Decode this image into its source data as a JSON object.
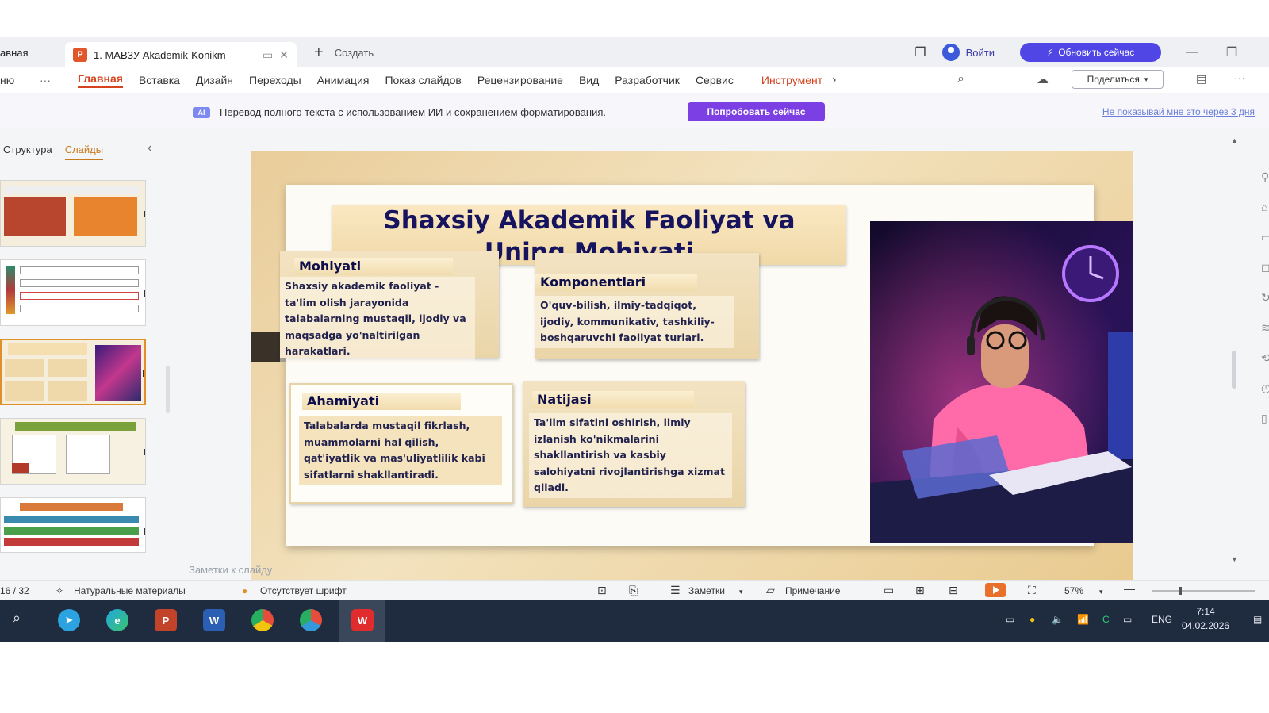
{
  "titlebar": {
    "home_tab": "авная",
    "doc_tab": {
      "badge": "P",
      "name": "1. МАВЗУ Akademik-Konikm"
    },
    "new_label": "Создать",
    "login_label": "Войти",
    "update_label": "Обновить сейчас"
  },
  "ribbon": {
    "menu_label": "ню",
    "tabs": [
      "Главная",
      "Вставка",
      "Дизайн",
      "Переходы",
      "Анимация",
      "Показ слайдов",
      "Рецензирование",
      "Вид",
      "Разработчик",
      "Сервис"
    ],
    "tools_label": "Инструмент",
    "share_label": "Поделиться"
  },
  "banner": {
    "ai_badge": "AI",
    "text": "Перевод полного текста с использованием ИИ и сохранением форматирования.",
    "try_label": "Попробовать сейчас",
    "dismiss_label": "Не показывай мне это через 3 дня"
  },
  "leftpanel": {
    "tab_structure": "Структура",
    "tab_slides": "Слайды",
    "add_label": "+"
  },
  "slide": {
    "title_line1": "Shaxsiy Akademik Faoliyat va",
    "title_line2": "Uning Mohiyati",
    "cards": {
      "mohiyati": {
        "heading": "Mohiyati",
        "body": "Shaxsiy akademik faoliyat - ta'lim olish jarayonida talabalarning mustaqil, ijodiy va maqsadga yo'naltirilgan harakatlari."
      },
      "komponentlari": {
        "heading": "Komponentlari",
        "body": "O'quv-bilish, ilmiy-tadqiqot, ijodiy, kommunikativ, tashkiliy-boshqaruvchi faoliyat turlari."
      },
      "ahamiyati": {
        "heading": "Ahamiyati",
        "body": "Talabalarda mustaqil fikrlash, muammolarni hal qilish, qat'iyatlik va mas'uliyatlilik kabi sifatlarni shakllantiradi."
      },
      "natijasi": {
        "heading": "Natijasi",
        "body": "Ta'lim sifatini oshirish, ilmiy izlanish ko'nikmalarini shakllantirish va kasbiy salohiyatni rivojlantirishga xizmat qiladi."
      }
    }
  },
  "notes_placeholder": "Заметки к слайду",
  "statusbar": {
    "slide_counter": "16 / 32",
    "materials": "Натуральные материалы",
    "missing_font": "Отсутствует шрифт",
    "notes": "Заметки",
    "comment": "Примечание",
    "zoom": "57%"
  },
  "taskbar": {
    "lang": "ENG",
    "time": "7:14",
    "date": "04.02.2026"
  },
  "colors": {
    "accent": "#d5431f",
    "ai_purple": "#7b3fe4",
    "update_blue": "#4f46e5",
    "title_navy": "#16145f"
  }
}
